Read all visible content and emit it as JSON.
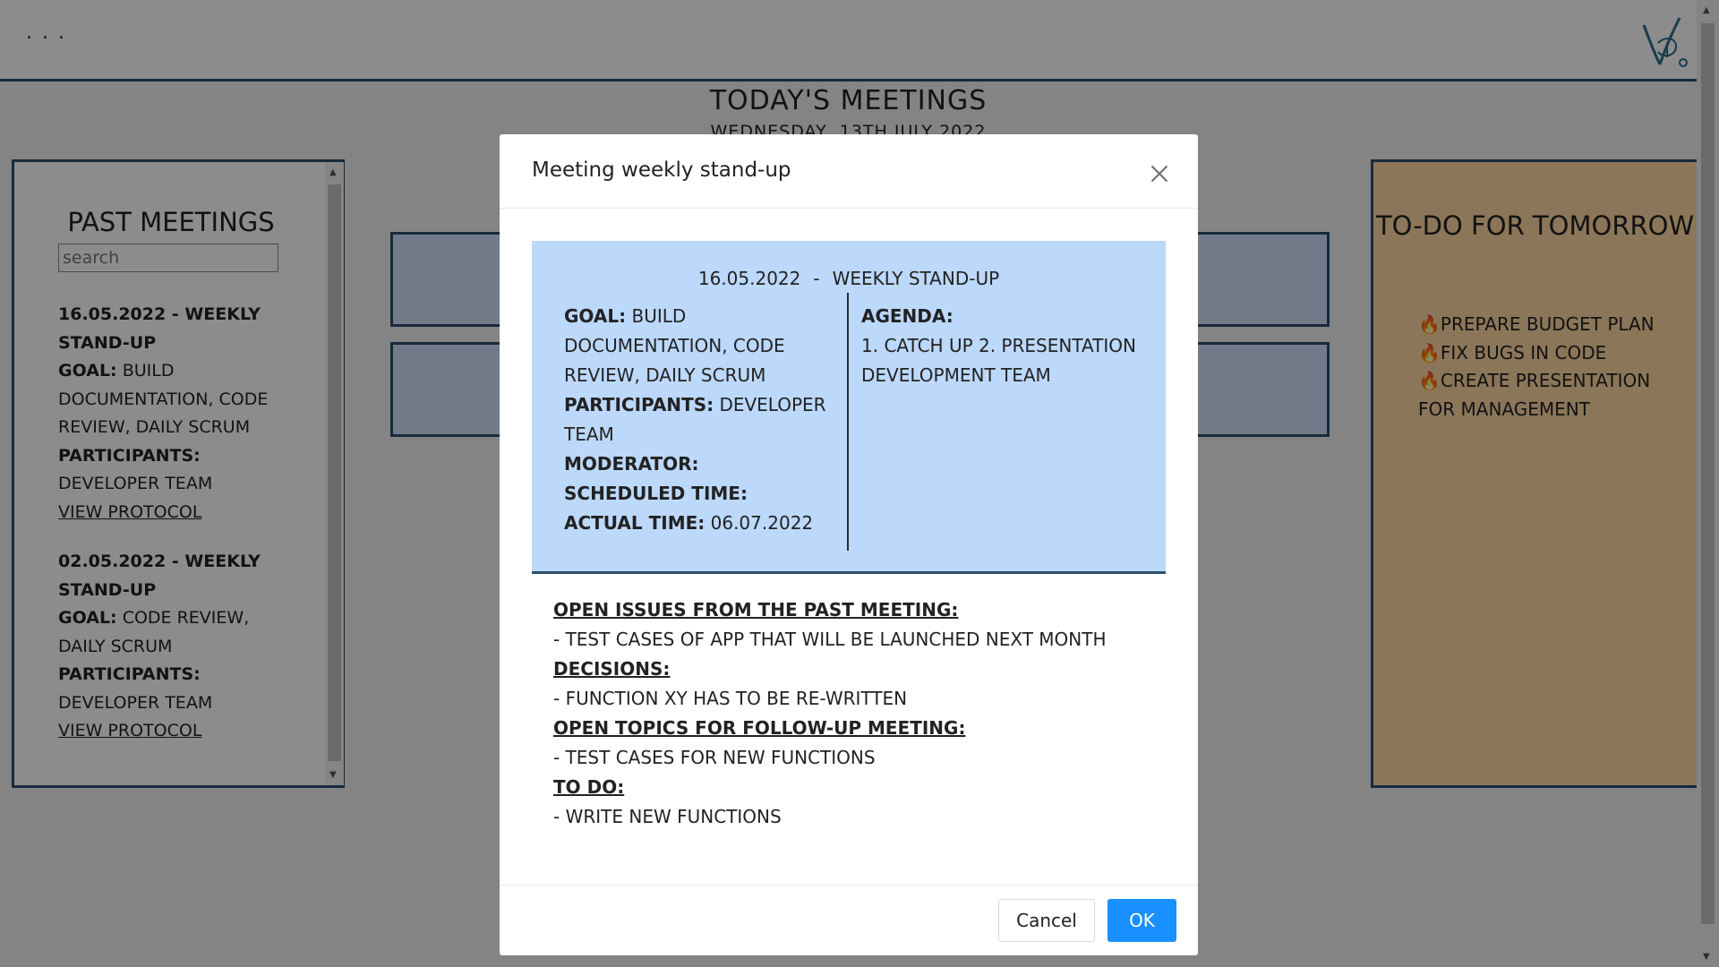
{
  "header": {
    "menu_label": ". . ."
  },
  "page": {
    "title": "TODAY'S MEETINGS",
    "date": "WEDNESDAY, 13TH JULY 2022"
  },
  "past_meetings": {
    "title": "PAST MEETINGS",
    "search_placeholder": "search",
    "items": [
      {
        "heading": "16.05.2022 - WEEKLY STAND-UP",
        "goal_label": "GOAL:",
        "goal": "BUILD DOCUMENTATION, CODE REVIEW, DAILY SCRUM",
        "participants_label": "PARTICIPANTS:",
        "participants": "DEVELOPER TEAM",
        "link": "VIEW PROTOCOL"
      },
      {
        "heading": "02.05.2022 - WEEKLY STAND-UP",
        "goal_label": "GOAL:",
        "goal": "CODE REVIEW, DAILY SCRUM",
        "participants_label": "PARTICIPANTS:",
        "participants": "DEVELOPER TEAM",
        "link": "VIEW PROTOCOL"
      }
    ]
  },
  "todo": {
    "title": "TO-DO FOR TOMORROW",
    "icon": "fire-icon",
    "items": [
      "PREPARE BUDGET PLAN",
      "FIX BUGS IN CODE",
      "CREATE PRESENTATION FOR MANAGEMENT"
    ]
  },
  "modal": {
    "title": "Meeting weekly stand-up",
    "card": {
      "date": "16.05.2022",
      "separator": "-",
      "name": "WEEKLY STAND-UP",
      "goal_label": "GOAL:",
      "goal": "BUILD DOCUMENTATION, CODE REVIEW, DAILY SCRUM",
      "participants_label": "PARTICIPANTS:",
      "participants": "DEVELOPER TEAM",
      "moderator_label": "MODERATOR:",
      "scheduled_label": "SCHEDULED TIME:",
      "actual_label": "ACTUAL TIME:",
      "actual": "06.07.2022",
      "agenda_label": "AGENDA:",
      "agenda": "1. CATCH UP 2. PRESENTATION DEVELOPMENT TEAM"
    },
    "notes": {
      "open_issues_label": "OPEN ISSUES FROM THE PAST MEETING:",
      "open_issues": "- TEST CASES OF APP THAT WILL BE LAUNCHED NEXT MONTH",
      "decisions_label": "DECISIONS:",
      "decisions": "- FUNCTION XY HAS TO BE RE-WRITTEN",
      "followup_label": "OPEN TOPICS FOR FOLLOW-UP MEETING:",
      "followup": "- TEST CASES FOR NEW FUNCTIONS",
      "todo_label": "TO DO:",
      "todo": "- WRITE NEW FUNCTIONS"
    },
    "cancel_label": "Cancel",
    "ok_label": "OK"
  },
  "colors": {
    "accent_blue": "#1890ff",
    "panel_border": "#2b4d6e",
    "card_blue": "#bcd8fa",
    "todo_orange": "#ffd7a3"
  }
}
